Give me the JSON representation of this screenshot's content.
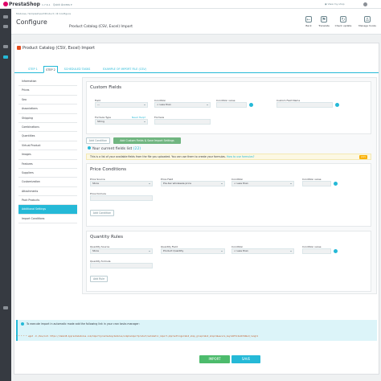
{
  "topbar": {
    "logo": "PrestaShop",
    "version": "1.7.6.1",
    "quick_access": "Quick Access ▾",
    "view_shop": "View my shop",
    "user_icon": "user-icon"
  },
  "header": {
    "breadcrumb": "Modules  /  SimpleImportProduct  /  ⚙ Configure",
    "title": "Configure",
    "subtitle": "Product Catalog (CSV, Excel) Import",
    "toolbar": [
      {
        "label": "Back",
        "icon": "←"
      },
      {
        "label": "Translate",
        "icon": "⚑"
      },
      {
        "label": "Check update",
        "icon": "↻"
      },
      {
        "label": "Manage hooks",
        "icon": "⚓"
      }
    ]
  },
  "panel": {
    "title": "Product Catalog (CSV, Excel) Import",
    "tabs": [
      "STEP 1",
      "STEP 2",
      "SCHEDULED TASKS",
      "EXAMPLE OF IMPORT FILE (CSV)"
    ]
  },
  "left_nav": [
    "Information",
    "Prices",
    "Seo",
    "Associations",
    "Shipping",
    "Combinations",
    "Quantities",
    "Virtual Product",
    "Images",
    "Features",
    "Suppliers",
    "Customization",
    "Attachments",
    "Pack Products",
    "Additional Settings",
    "Import Conditions"
  ],
  "custom_fields": {
    "title": "Custom Fields",
    "field_label": "Field",
    "field_value": "---",
    "condition_label": "Condition",
    "condition_value": "< Less than",
    "condition_value_label": "Condition value",
    "custom_field_name_label": "Custom Field Name",
    "formula_type_label": "Formula Type",
    "formula_type_value": "String",
    "need_help": "Need Help?",
    "formula_label": "Formula",
    "add_condition": "Add Condition",
    "add_save": "Add Custom Fields & Save Import Settings"
  },
  "fields_list": {
    "title": "Your current fields list",
    "count": "(22)",
    "notice": "This is a list of your available fields from the file you uploaded. You can use them to create your formulas.",
    "notice_link": "How to use formulas?"
  },
  "price_conditions": {
    "title": "Price Conditions",
    "price_source_label": "Price Source",
    "price_source_value": "Store",
    "price_field_label": "Price Field",
    "price_field_value": "Pre-tax wholesale price",
    "condition_label": "Condition",
    "condition_value": "< Less than",
    "condition_value_label": "Condition value",
    "price_formula_label": "Price formula",
    "add_condition": "Add Condition"
  },
  "quantity_rules": {
    "title": "Quantity Rules",
    "source_label": "Quantity Source",
    "source_value": "Store",
    "field_label": "Quantity Field",
    "field_value": "Product Quantity",
    "condition_label": "Condition",
    "condition_value": "< Less than",
    "condition_value_label": "Condition value",
    "formula_label": "Quantity formula",
    "add_rule": "Add Rule"
  },
  "alert": {
    "text": "To execute import in automatic mode add the following link in your cron tasks manager:",
    "command": "* * * * * wget -O /dev/null https://demo18.myprestamodules.com/import/prestashop/modules/simpleimportproduct/automatic_import.php?settings=1&id_shop_group=1&id_shop=1&secure_key=a9f3c2e1b7d4&id_lang=1"
  },
  "buttons": {
    "import": "IMPORT",
    "save": "SAVE"
  },
  "colors": {
    "accent": "#25b9d7",
    "green": "#70b580",
    "sidebar": "#363a41"
  }
}
